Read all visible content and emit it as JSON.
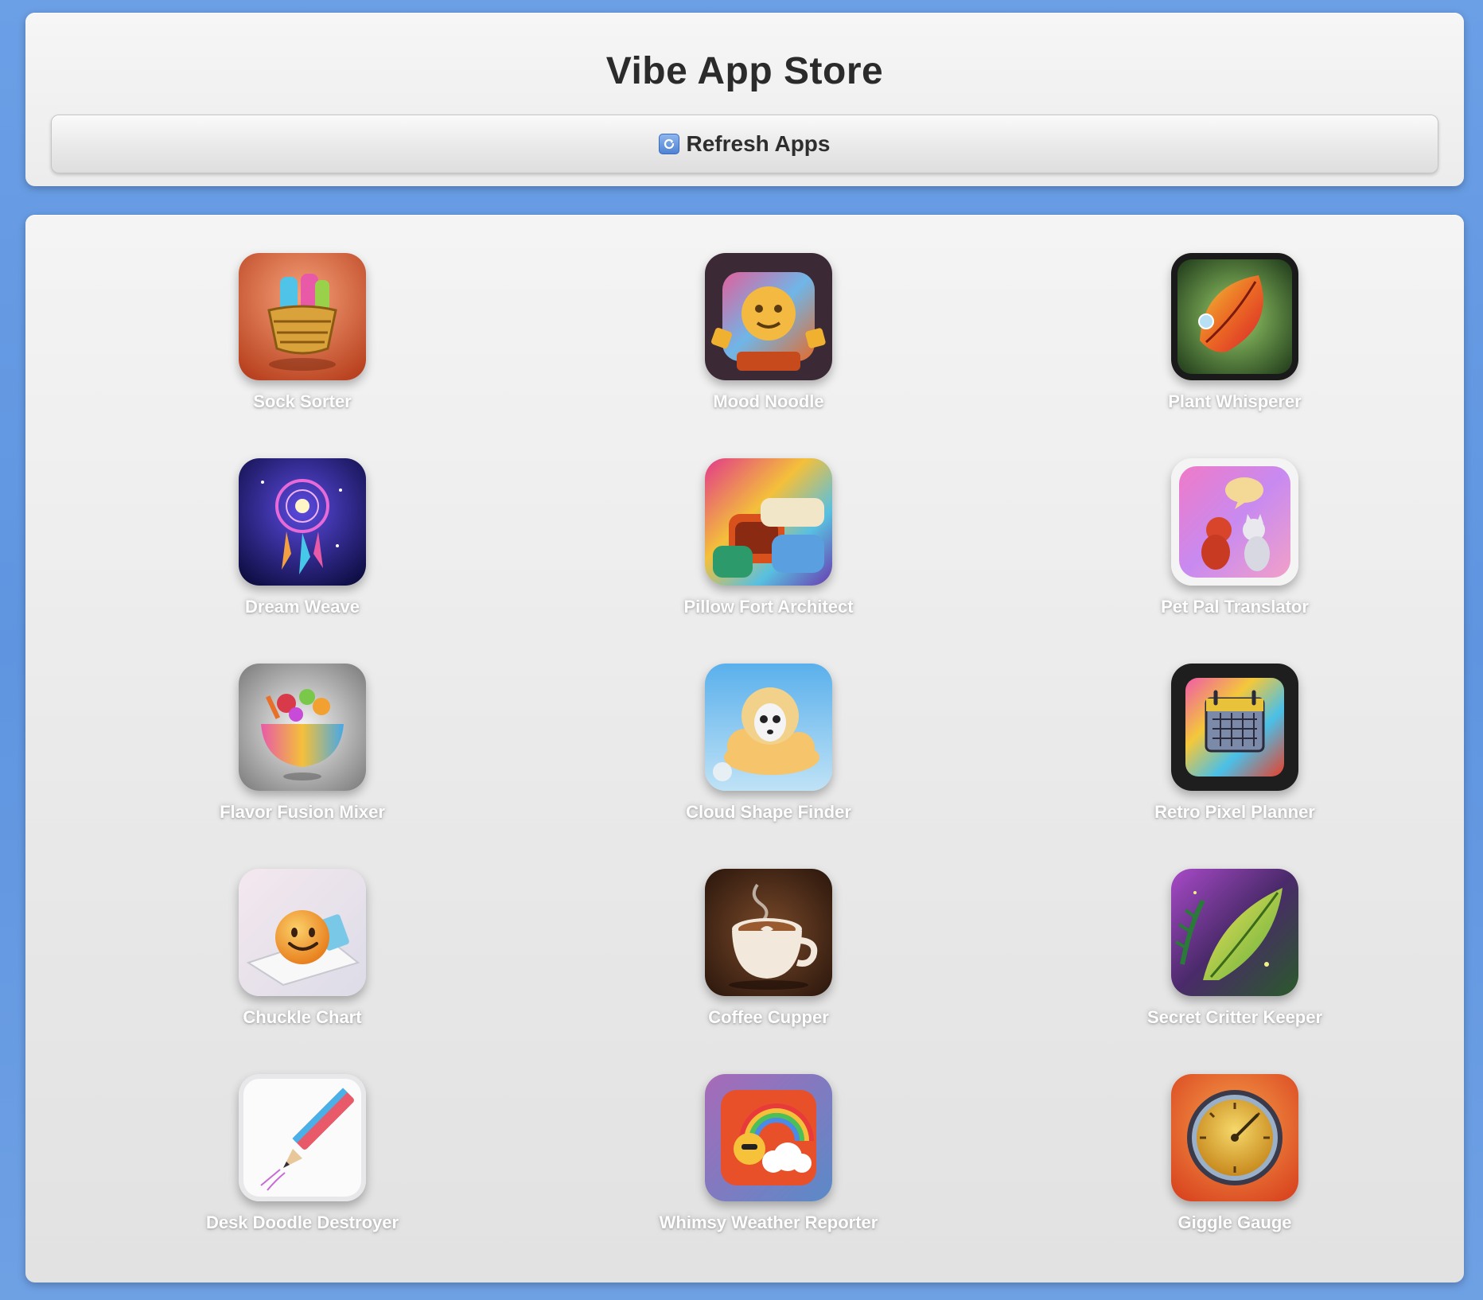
{
  "header": {
    "title": "Vibe App Store",
    "refresh_label": "Refresh Apps",
    "refresh_icon": "refresh-icon"
  },
  "apps": [
    {
      "name": "Sock Sorter",
      "icon": "sock-basket-icon"
    },
    {
      "name": "Mood Noodle",
      "icon": "mood-noodle-icon"
    },
    {
      "name": "Plant Whisperer",
      "icon": "leaf-icon"
    },
    {
      "name": "Dream Weave",
      "icon": "dreamcatcher-icon"
    },
    {
      "name": "Pillow Fort Architect",
      "icon": "pillow-fort-icon"
    },
    {
      "name": "Pet Pal Translator",
      "icon": "pets-speech-icon"
    },
    {
      "name": "Flavor Fusion Mixer",
      "icon": "food-bowl-icon"
    },
    {
      "name": "Cloud Shape Finder",
      "icon": "cloud-creature-icon"
    },
    {
      "name": "Retro Pixel Planner",
      "icon": "calendar-icon"
    },
    {
      "name": "Chuckle Chart",
      "icon": "smiley-icon"
    },
    {
      "name": "Coffee Cupper",
      "icon": "coffee-cup-icon"
    },
    {
      "name": "Secret Critter Keeper",
      "icon": "fern-icon"
    },
    {
      "name": "Desk Doodle Destroyer",
      "icon": "pencil-icon"
    },
    {
      "name": "Whimsy Weather Reporter",
      "icon": "sun-cloud-rainbow-icon"
    },
    {
      "name": "Giggle Gauge",
      "icon": "gauge-icon"
    }
  ]
}
